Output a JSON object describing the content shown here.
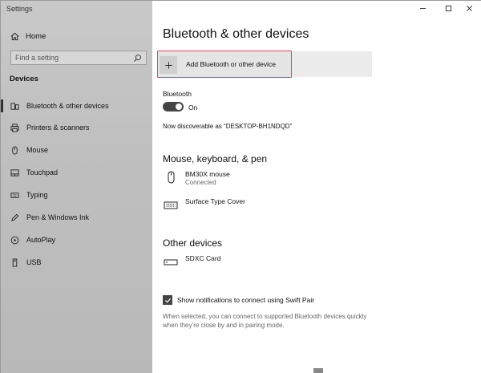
{
  "app": {
    "title": "Settings"
  },
  "sidebar": {
    "home_label": "Home",
    "search_placeholder": "Find a setting",
    "section_title": "Devices",
    "items": [
      {
        "label": "Bluetooth & other devices",
        "icon": "bluetooth-devices-icon",
        "active": true
      },
      {
        "label": "Printers & scanners",
        "icon": "printer-icon"
      },
      {
        "label": "Mouse",
        "icon": "mouse-icon"
      },
      {
        "label": "Touchpad",
        "icon": "touchpad-icon"
      },
      {
        "label": "Typing",
        "icon": "keyboard-icon"
      },
      {
        "label": "Pen & Windows Ink",
        "icon": "pen-icon"
      },
      {
        "label": "AutoPlay",
        "icon": "autoplay-icon"
      },
      {
        "label": "USB",
        "icon": "usb-icon"
      }
    ]
  },
  "main": {
    "title": "Bluetooth & other devices",
    "add_button_label": "Add Bluetooth or other device",
    "bluetooth_label": "Bluetooth",
    "bluetooth_state": "On",
    "discoverable": "Now discoverable as “DESKTOP-BH1NDQD”",
    "section_mkp": "Mouse, keyboard, & pen",
    "devices_mkp": [
      {
        "name": "BM30X mouse",
        "status": "Connected",
        "icon": "mouse-icon"
      },
      {
        "name": "Surface Type Cover",
        "icon": "keyboard-icon"
      }
    ],
    "section_other": "Other devices",
    "devices_other": [
      {
        "name": "SDXC Card",
        "icon": "sd-card-icon"
      }
    ],
    "swift_pair_label": "Show notifications to connect using Swift Pair",
    "swift_pair_checked": true,
    "swift_pair_desc": "When selected, you can connect to supported Bluetooth devices quickly when they’re close by and in pairing mode."
  },
  "colors": {
    "highlight": "#e2484f",
    "sidebar_bg": "#c4c4c4",
    "toggle_on": "#444444"
  }
}
